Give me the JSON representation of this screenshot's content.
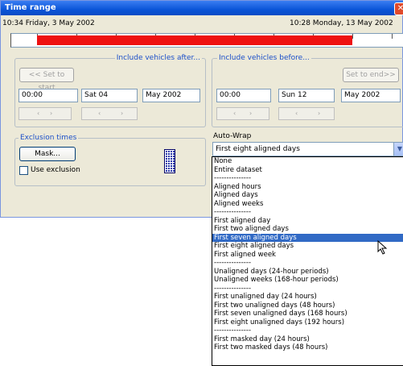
{
  "window": {
    "title": "Time range",
    "close_glyph": "✕"
  },
  "range": {
    "start_label": "10:34 Friday, 3 May 2002",
    "end_label": "10:28 Monday, 13 May 2002"
  },
  "after": {
    "legend": "Include vehicles after...",
    "set_button": "<< Set to start",
    "time": "00:00",
    "day": "Sat 04",
    "month": "May 2002"
  },
  "before": {
    "legend": "Include vehicles before...",
    "set_button": "Set to end>>",
    "time": "00:00",
    "day": "Sun 12",
    "month": "May 2002"
  },
  "spinner": {
    "left": "‹",
    "right": "›"
  },
  "exclusion": {
    "legend": "Exclusion times",
    "mask_button": "Mask...",
    "use_label": "Use exclusion",
    "use_checked": false
  },
  "autowrap": {
    "label": "Auto-Wrap",
    "selected": "First eight aligned days",
    "options": [
      "None",
      "Entire dataset",
      "---------------",
      "Aligned hours",
      "Aligned days",
      "Aligned weeks",
      "---------------",
      "First aligned day",
      "First two aligned days",
      "First seven aligned days",
      "First eight aligned days",
      "First aligned week",
      "---------------",
      "Unaligned days (24-hour periods)",
      "Unaligned weeks (168-hour periods)",
      "---------------",
      "First unaligned day (24 hours)",
      "First two unaligned days (48 hours)",
      "First seven unaligned days (168 hours)",
      "First eight unaligned days (192 hours)",
      "---------------",
      "First masked day (24 hours)",
      "First two masked days (48 hours)"
    ],
    "highlighted_index": 9
  },
  "colors": {
    "range_bar": "#ee1111",
    "highlight": "#316ac5",
    "legend_text": "#1b4fc9"
  }
}
